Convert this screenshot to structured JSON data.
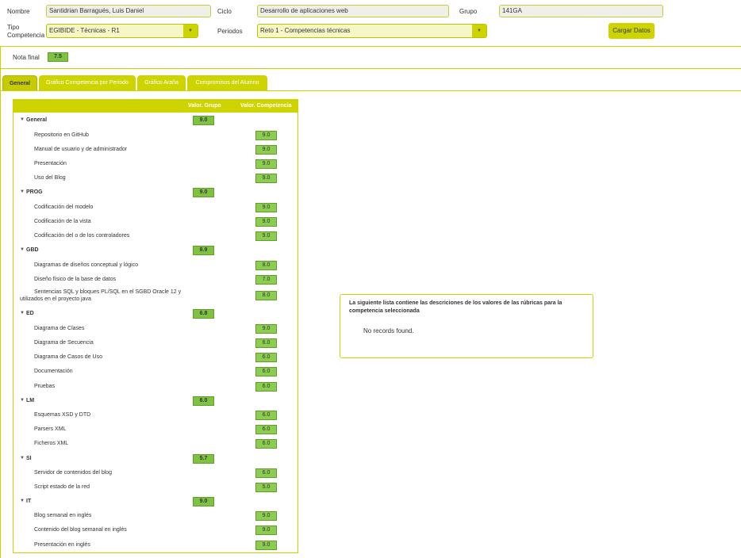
{
  "form": {
    "nombre_label": "Nombre",
    "nombre_value": "Santidrian Barragués, Luis Daniel",
    "ciclo_label": "Ciclo",
    "ciclo_value": "Desarrollo de aplicaciones web",
    "grupo_label": "Grupo",
    "grupo_value": "141GA",
    "tipo_label": "Tipo Competencia",
    "tipo_value": "EGIBIDE - Técnicas - R1",
    "periodos_label": "Periodos",
    "periodos_value": "Reto 1 - Competencias técnicas",
    "cargar_label": "Cargar Datos",
    "nota_label": "Nota final",
    "nota_value": "7.5"
  },
  "tabs": [
    {
      "label": "General"
    },
    {
      "label": "Gráfico Competencia por Periodo"
    },
    {
      "label": "Gráfico Araña"
    },
    {
      "label": "Compromisos del Alumno"
    }
  ],
  "tree": {
    "col_grupo": "Valor. Grupo",
    "col_competencia": "Valor. Competencia",
    "groups": [
      {
        "name": "General",
        "value": "9.0",
        "items": [
          {
            "name": "Repositorio en GitHub",
            "value": "9.0"
          },
          {
            "name": "Manual de usuario y de administrador",
            "value": "9.0"
          },
          {
            "name": "Presentación",
            "value": "9.0"
          },
          {
            "name": "Uso del Blog",
            "value": "9.0"
          }
        ]
      },
      {
        "name": "PROG",
        "value": "9.0",
        "items": [
          {
            "name": "Codificación del modelo",
            "value": "9.0"
          },
          {
            "name": "Codificación de la vista",
            "value": "9.0"
          },
          {
            "name": "Codificación del o de los controladores",
            "value": "9.0"
          }
        ]
      },
      {
        "name": "GBD",
        "value": "8.9",
        "items": [
          {
            "name": "Diagramas de diseños conceptual y lógico",
            "value": "8.0"
          },
          {
            "name": "Diseño físico de la base de datos",
            "value": "7.0"
          },
          {
            "name": "Sentencias SQL y bloques PL/SQL en el SGBD Oracle 12 y utilizados en el proyecto java",
            "value": "8.0"
          }
        ]
      },
      {
        "name": "ED",
        "value": "6.8",
        "items": [
          {
            "name": "Diagrama de Clases",
            "value": "9.0"
          },
          {
            "name": "Diagrama de Secuencia",
            "value": "6.0"
          },
          {
            "name": "Diagrama de Casos de Uso",
            "value": "6.0"
          },
          {
            "name": "Documentación",
            "value": "6.0"
          },
          {
            "name": "Pruebas",
            "value": "6.0"
          }
        ]
      },
      {
        "name": "LM",
        "value": "6.0",
        "items": [
          {
            "name": "Esquemas XSD y DTD",
            "value": "6.0"
          },
          {
            "name": "Parsers XML",
            "value": "6.0"
          },
          {
            "name": "Ficheros XML",
            "value": "6.0"
          }
        ]
      },
      {
        "name": "SI",
        "value": "5.7",
        "items": [
          {
            "name": "Servidor de contenidos del blog",
            "value": "6.0"
          },
          {
            "name": "Script estado de la red",
            "value": "5.0"
          }
        ]
      },
      {
        "name": "IT",
        "value": "9.0",
        "items": [
          {
            "name": "Blog semanal en inglés",
            "value": "9.0"
          },
          {
            "name": "Contenido del blog semanal en inglés",
            "value": "9.0"
          },
          {
            "name": "Presentación en inglés",
            "value": "9.0"
          }
        ]
      }
    ]
  },
  "info_panel": {
    "title": "La siguiente lista contiene las descriciones de los valores de las rúbricas para la competencia seleccionada",
    "empty_text": "No records found."
  },
  "colors": {
    "accent": "#cdd400",
    "value_green": "#7fc242"
  }
}
